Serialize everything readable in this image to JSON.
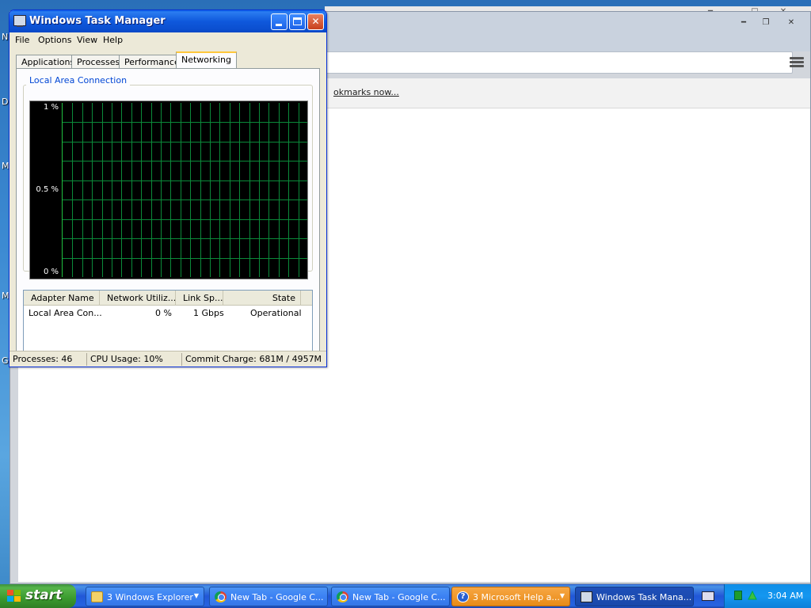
{
  "desktop": {
    "letters": [
      "N",
      "D",
      "M",
      "M",
      "G"
    ]
  },
  "task_manager": {
    "title": "Windows Task Manager",
    "menu": [
      "File",
      "Options",
      "View",
      "Help"
    ],
    "tabs": [
      "Applications",
      "Processes",
      "Performance",
      "Networking"
    ],
    "active_tab": "Networking",
    "group_label": "Local Area Connection",
    "graph": {
      "axis_labels": [
        "1 %",
        "0.5 %",
        "0 %"
      ],
      "grid_color": "#0b8a3a"
    },
    "table": {
      "columns": [
        "Adapter Name",
        "Network Utiliz...",
        "Link Sp...",
        "State"
      ],
      "rows": [
        [
          "Local Area Con...",
          "0 %",
          "1 Gbps",
          "Operational"
        ]
      ]
    },
    "status": {
      "processes": "Processes: 46",
      "cpu": "CPU Usage: 10%",
      "commit": "Commit Charge: 681M / 4957M"
    }
  },
  "chrome": {
    "bookmark_text": "okmarks now..."
  },
  "taskbar": {
    "start_label": "start",
    "tasks": [
      {
        "label": "3 Windows Explorer",
        "icon": "folder-icon",
        "state": "normal",
        "group": true
      },
      {
        "label": "New Tab - Google C...",
        "icon": "chrome-icon",
        "state": "normal",
        "group": false
      },
      {
        "label": "New Tab - Google C...",
        "icon": "chrome-icon",
        "state": "normal",
        "group": false
      },
      {
        "label": "3 Microsoft Help a...",
        "icon": "help-icon",
        "state": "flash",
        "group": true
      },
      {
        "label": "Windows Task Mana...",
        "icon": "task-manager-icon",
        "state": "active",
        "group": false
      }
    ],
    "clock": "3:04 AM"
  }
}
